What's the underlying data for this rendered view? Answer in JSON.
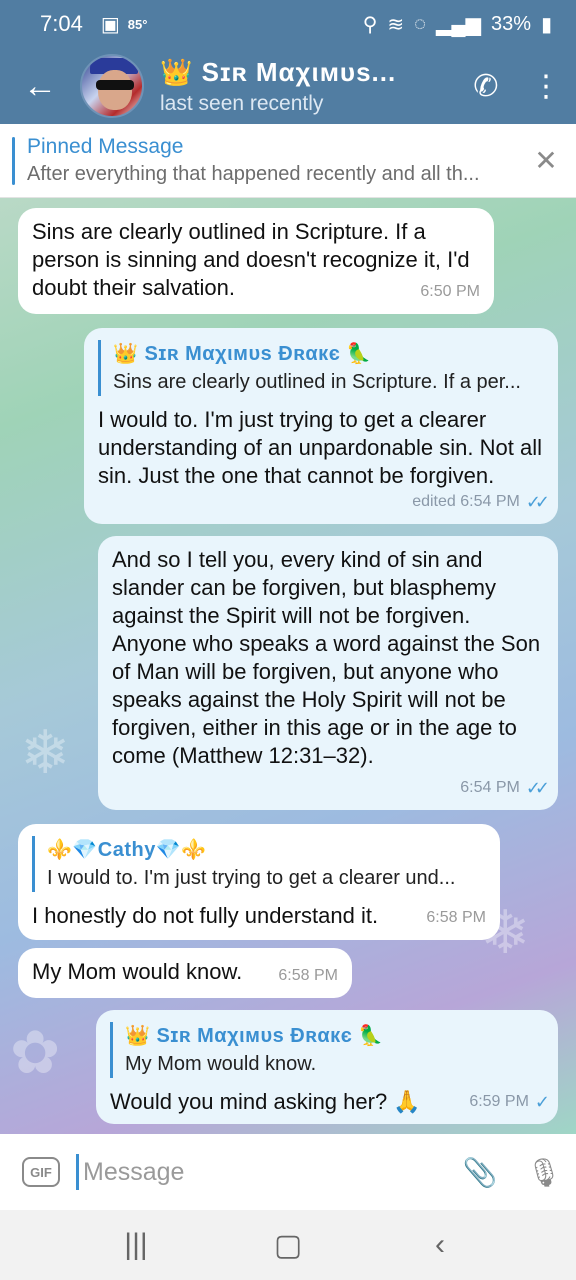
{
  "status_bar": {
    "time": "7:04",
    "temperature": "85°",
    "battery": "33%"
  },
  "header": {
    "title": "👑 Sɪʀ Mαχιмυѕ...",
    "subtitle": "last seen recently"
  },
  "pinned": {
    "title": "Pinned Message",
    "body": "After everything that happened recently and all th..."
  },
  "messages": [
    {
      "dir": "in",
      "text": "Sins are clearly outlined in Scripture. If a person is sinning and doesn't recognize it, I'd doubt their salvation.",
      "time": "6:50 PM"
    },
    {
      "dir": "out",
      "reply_name": "👑 Sɪʀ Mαχιмυѕ Ɖʀαкє 🦜",
      "reply_text": "Sins are clearly outlined in Scripture. If a per...",
      "text": "I would to. I'm just trying to get a clearer understanding of an unpardonable sin. Not all sin. Just the one that cannot be forgiven.",
      "time": "edited 6:54 PM"
    },
    {
      "dir": "out",
      "text": "And so I tell you, every kind of sin and slander can be forgiven, but blasphemy against the Spirit will not be forgiven. Anyone who speaks a word against the Son of Man will be forgiven, but anyone who speaks against the Holy Spirit will not be forgiven, either in this age or in the age to come (Matthew 12:31–32).",
      "time": "6:54 PM"
    },
    {
      "dir": "in",
      "reply_name": "⚜️💎Cathy💎⚜️",
      "reply_text": "I would to. I'm just trying to get a clearer und...",
      "text": "I honestly do not fully understand it.",
      "time": "6:58 PM"
    },
    {
      "dir": "in",
      "text": "My Mom would know.",
      "time": "6:58 PM"
    },
    {
      "dir": "out",
      "reply_name": "👑 Sɪʀ Mαχιмυѕ Ɖʀαкє 🦜",
      "reply_text": "My Mom would know.",
      "text": "Would you mind asking her? 🙏",
      "time": "6:59 PM"
    }
  ],
  "input": {
    "placeholder": "Message",
    "gif_label": "GIF"
  },
  "colors": {
    "header": "#517da2",
    "accent": "#3a8fd1",
    "outgoing_bubble": "#e9f5fc",
    "incoming_bubble": "#ffffff"
  }
}
